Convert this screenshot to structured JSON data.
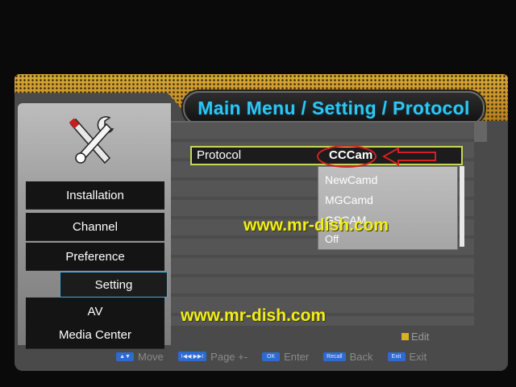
{
  "header": {
    "title": "Main Menu / Setting / Protocol"
  },
  "sidebar": {
    "items": [
      {
        "label": "Installation"
      },
      {
        "label": "Channel"
      },
      {
        "label": "Preference"
      },
      {
        "label": "Setting",
        "selected": true
      },
      {
        "label": "AV"
      },
      {
        "label": "Media Center"
      }
    ]
  },
  "protocol": {
    "label": "Protocol",
    "value": "CCCam",
    "options": [
      "NewCamd",
      "MGCamd",
      "GSCAM",
      "Off"
    ]
  },
  "watermark": {
    "text1": "www.mr-dish.com",
    "text2": "www.mr-dish.com"
  },
  "edit_hint": "Edit",
  "footer": {
    "keys": [
      {
        "key": "▲▼",
        "label": "Move"
      },
      {
        "key": "I◀◀ ▶▶I",
        "label": "Page +-"
      },
      {
        "key": "OK",
        "label": "Enter"
      },
      {
        "key": "Recall",
        "label": "Back"
      },
      {
        "key": "Exit",
        "label": "Exit"
      }
    ]
  },
  "colors": {
    "title": "#2ec6f3",
    "header_gold": "#c8922a",
    "selection_border": "#c6d65a",
    "watermark": "#f3ee1c",
    "highlight_circle": "#d42020"
  },
  "icons": {
    "sidebar": "tools-icon",
    "pointer": "arrow-left-icon"
  }
}
